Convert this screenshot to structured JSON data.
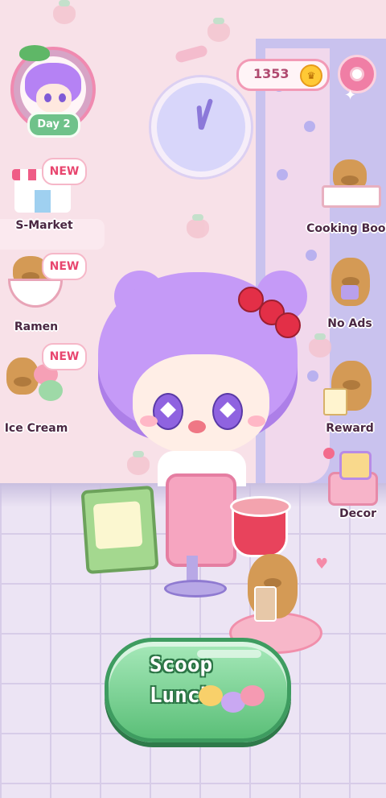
{
  "hud": {
    "day_label": "Day 2",
    "coins": "1353",
    "coin_icon": "coin-icon",
    "settings_icon": "gear-icon"
  },
  "left_menu": [
    {
      "label": "S-Market",
      "badge": "NEW",
      "icon": "store-icon"
    },
    {
      "label": "Ramen",
      "badge": "NEW",
      "icon": "ramen-bowl-icon"
    },
    {
      "label": "Ice Cream",
      "badge": "NEW",
      "icon": "ice-cream-icon"
    }
  ],
  "right_menu": [
    {
      "label": "Cooking Book",
      "icon": "cooking-book-icon"
    },
    {
      "label": "No Ads",
      "icon": "no-ads-icon"
    },
    {
      "label": "Reward",
      "icon": "reward-icon"
    },
    {
      "label": "Decor",
      "icon": "decor-icon"
    }
  ],
  "action_button": {
    "line1": "Scoop",
    "line2": "Lunch"
  },
  "colors": {
    "wall": "#f8e1e8",
    "floor": "#ece4f4",
    "accent_pink": "#f07ea5",
    "button_green": "#5bbf78",
    "hair_purple": "#c59af7"
  }
}
